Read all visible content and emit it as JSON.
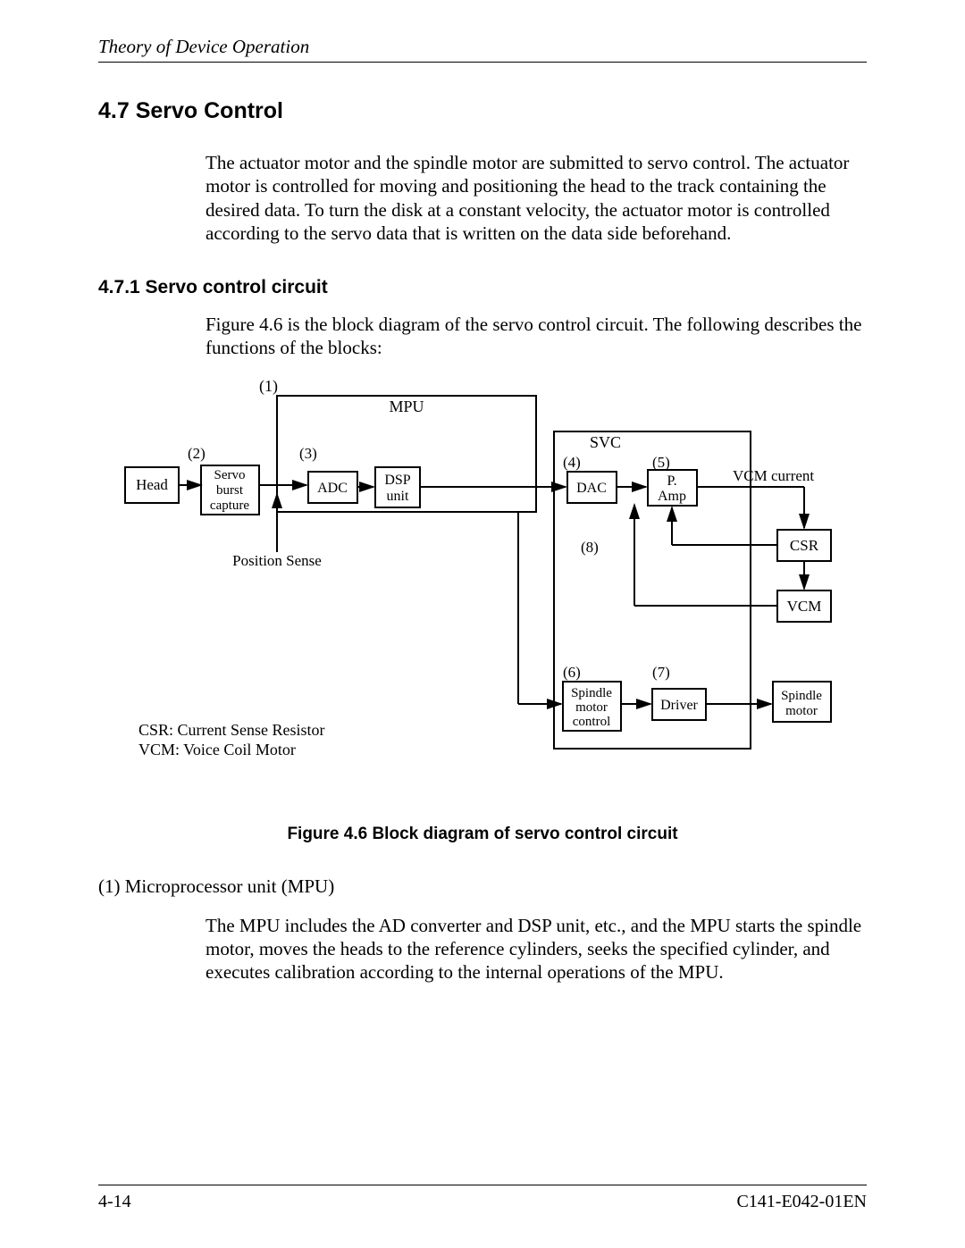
{
  "header": {
    "running": "Theory of Device Operation"
  },
  "section": {
    "number": "4.7",
    "title_full": "4.7  Servo Control",
    "para1": "The actuator motor and the spindle motor are submitted to servo control.  The actuator motor is controlled for moving and positioning the head to the track containing the desired data.  To turn the disk at a constant velocity, the actuator motor is controlled according to the servo data that is written on the data side beforehand."
  },
  "subsection": {
    "title_full": "4.7.1  Servo control circuit",
    "para1": "Figure 4.6 is the block diagram of the servo control circuit.  The following describes the functions of the blocks:"
  },
  "figure": {
    "caption": "Figure 4.6  Block diagram of servo control circuit",
    "labels": {
      "n1": "(1)",
      "n2": "(2)",
      "n3": "(3)",
      "n4": "(4)",
      "n5": "(5)",
      "n6": "(6)",
      "n7": "(7)",
      "n8": "(8)",
      "mpu": "MPU",
      "head": "Head",
      "servo1": "Servo",
      "servo2": "burst",
      "servo3": "capture",
      "adc": "ADC",
      "dsp1": "DSP",
      "dsp2": "unit",
      "svc": "SVC",
      "dac": "DAC",
      "pamp1": "P.",
      "pamp2": "Amp",
      "vcm_current": "VCM current",
      "csr": "CSR",
      "vcm": "VCM",
      "spm1": "Spindle",
      "spm2": "motor",
      "spm3": "control",
      "driver": "Driver",
      "sp1": "Spindle",
      "sp2": "motor",
      "pos_sense": "Position Sense",
      "legend_csr": "CSR:  Current Sense Resistor",
      "legend_vcm": "VCM:  Voice Coil Motor"
    }
  },
  "list": {
    "item1_head": "(1)  Microprocessor unit (MPU)",
    "item1_body": "The MPU includes the AD converter and DSP unit, etc., and the MPU starts the spindle motor, moves the heads to the reference cylinders, seeks the specified cylinder, and executes calibration according to the internal operations of the MPU."
  },
  "footer": {
    "page_num": "4-14",
    "doc_id": "C141-E042-01EN"
  }
}
